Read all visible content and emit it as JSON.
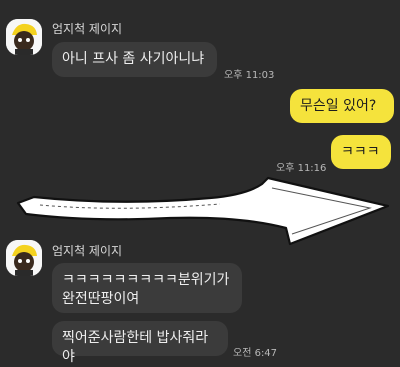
{
  "messages": {
    "group1": {
      "sender": "엄지척 제이지",
      "text": "아니 프사 좀 사기아니냐",
      "time": "오후 11:03"
    },
    "mine1": {
      "text": "무슨일 있어?"
    },
    "mine2": {
      "text": "ㅋㅋㅋ",
      "time": "오후 11:16"
    },
    "group2": {
      "sender": "엄지척 제이지",
      "text1_line1": "ㅋㅋㅋㅋㅋㅋㅋㅋㅋ분위기가",
      "text1_line2": "완전딴팡이여",
      "text2": "찍어준사람한테 밥사줘라야",
      "time": "오전 6:47"
    }
  },
  "colors": {
    "background": "#2b2b2b",
    "my_bubble": "#f5e33c",
    "their_bubble": "#3b3b3b"
  },
  "icons": {
    "avatar": "cartoon-character-avatar",
    "arrow": "hand-drawn-arrow-overlay"
  }
}
